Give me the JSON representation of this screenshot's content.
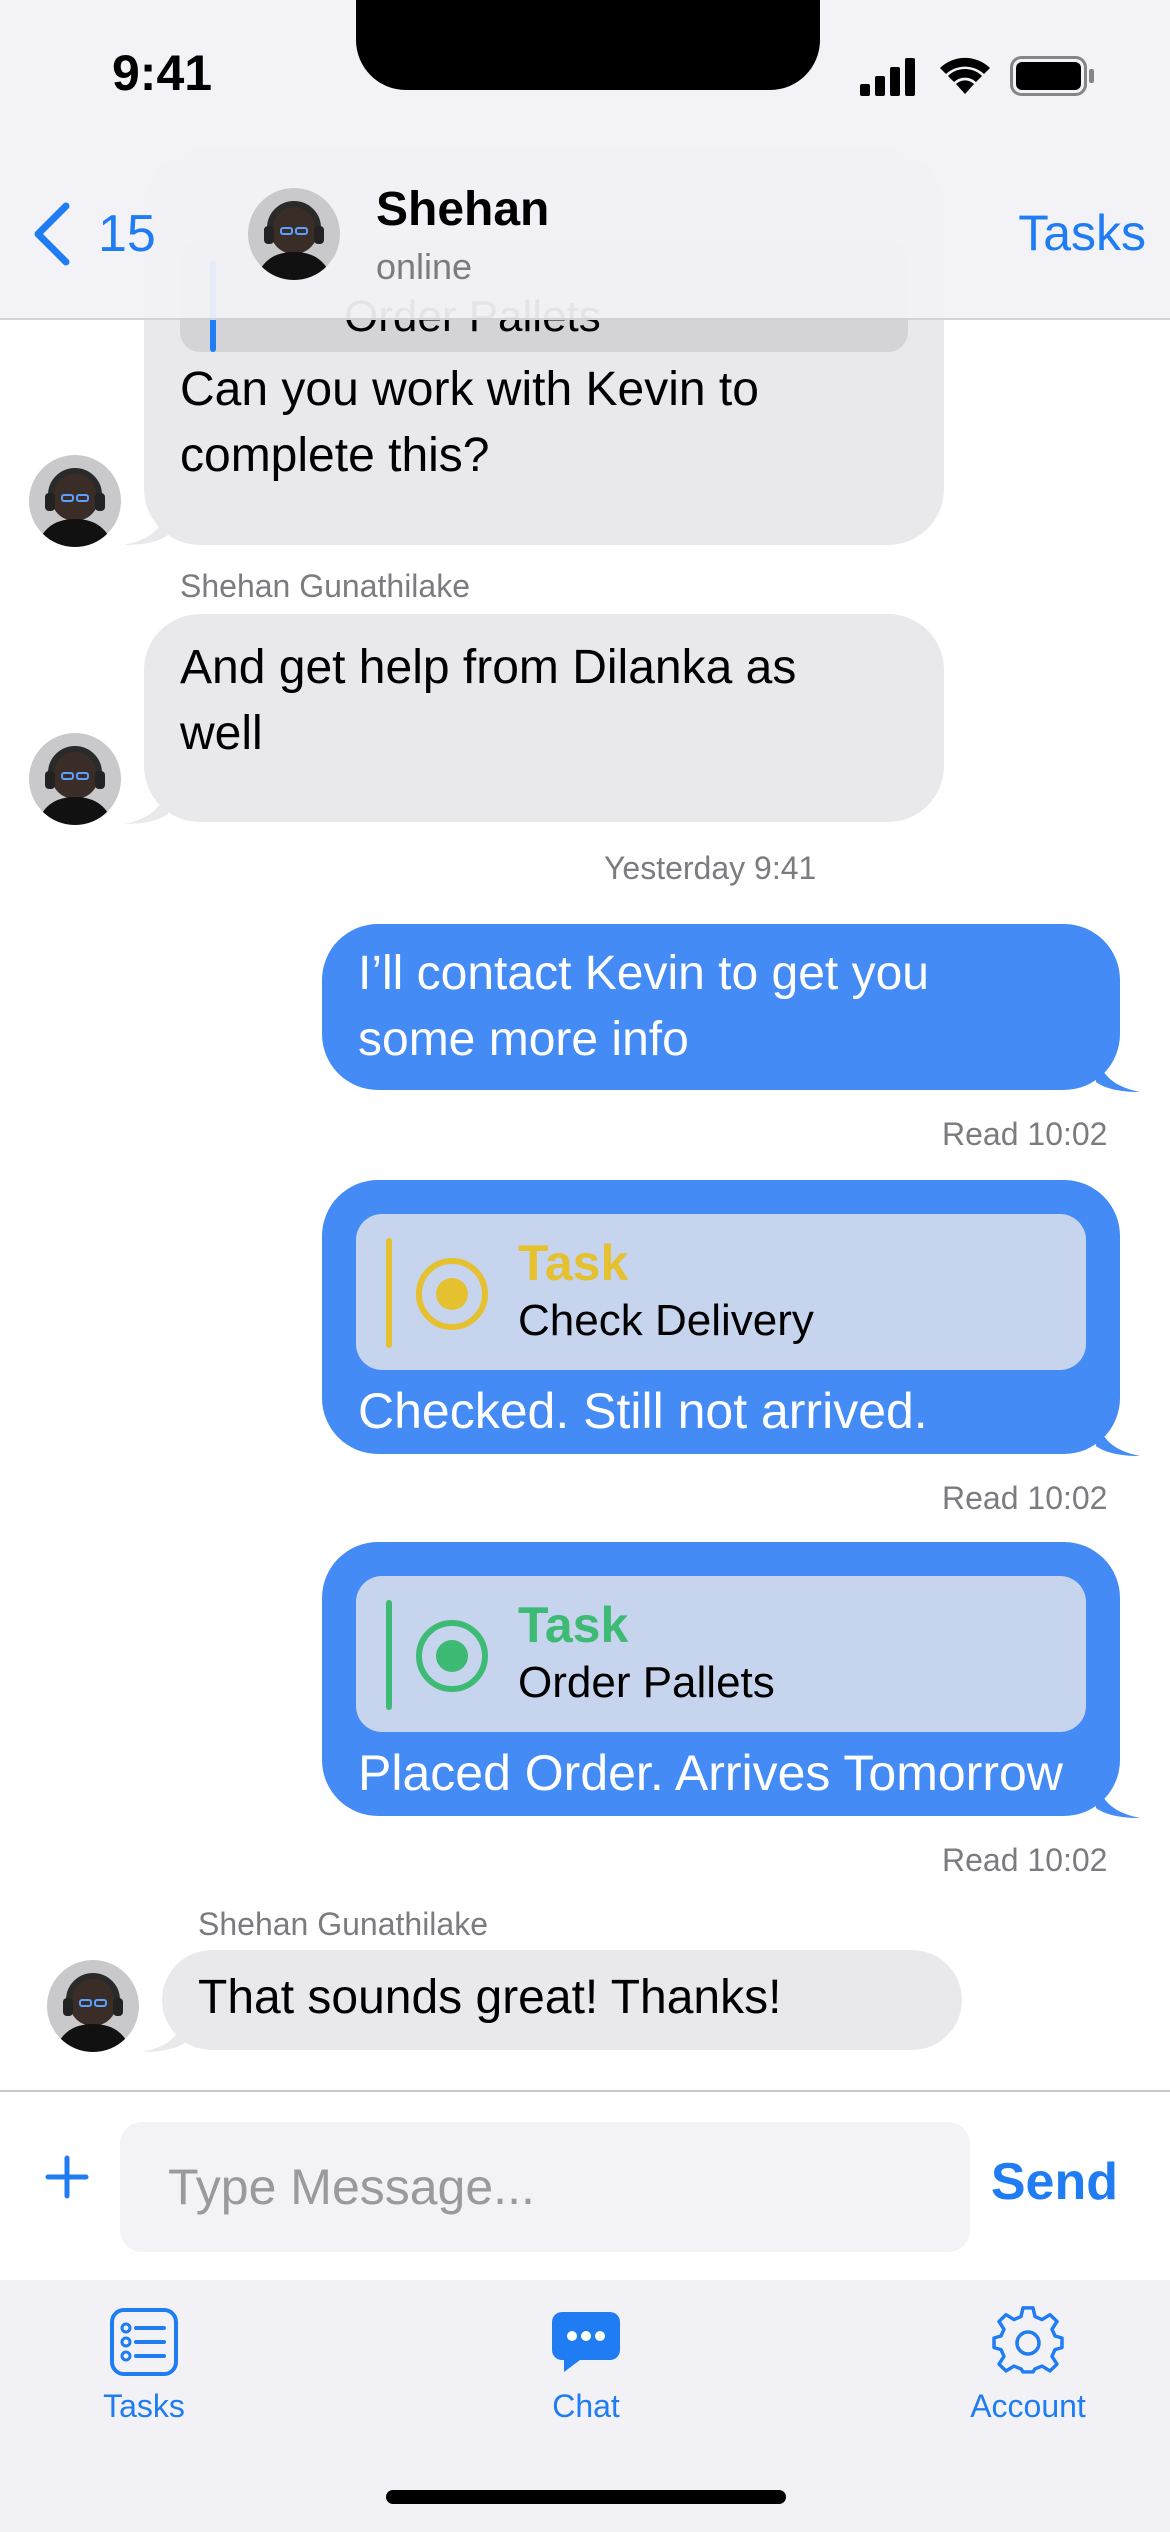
{
  "status_bar": {
    "time": "9:41"
  },
  "header": {
    "back_count": "15",
    "name": "Shehan",
    "status": "online",
    "tasks_label": "Tasks"
  },
  "messages": {
    "m1": {
      "quoted_task": "Order Pallets",
      "text_line1": "Can you work with Kevin to",
      "text_line2": "complete this?"
    },
    "m2": {
      "sender": "Shehan Gunathilake",
      "text_line1": "And get help from Dilanka as",
      "text_line2": "well"
    },
    "timestamp": "Yesterday 9:41",
    "m3": {
      "text_line1": "I’ll contact Kevin to get you",
      "text_line2": "some more info",
      "read": "Read 10:02"
    },
    "m4": {
      "task_label": "Task",
      "task_name": "Check Delivery",
      "text": "Checked. Still not arrived.",
      "read": "Read 10:02",
      "task_color": "#e5c12f"
    },
    "m5": {
      "task_label": "Task",
      "task_name": "Order Pallets",
      "text": "Placed Order. Arrives Tomorrow",
      "read": "Read 10:02",
      "task_color": "#3dba73"
    },
    "m6": {
      "sender": "Shehan Gunathilake",
      "text": "That sounds great! Thanks!"
    }
  },
  "composer": {
    "placeholder": "Type Message...",
    "send_label": "Send"
  },
  "tabbar": [
    {
      "label": "Tasks",
      "icon": "list-icon"
    },
    {
      "label": "Chat",
      "icon": "chat-bubble-icon"
    },
    {
      "label": "Account",
      "icon": "gear-icon"
    }
  ],
  "colors": {
    "accent": "#1f7cf3",
    "outgoing_bubble": "#448bf5",
    "incoming_bubble": "#e9e9eb"
  }
}
